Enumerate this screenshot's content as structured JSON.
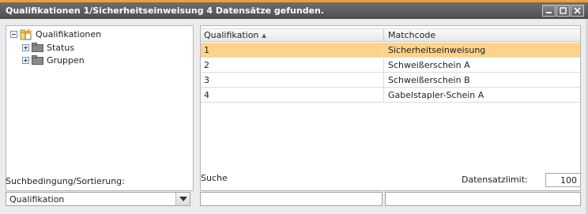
{
  "window": {
    "title": "Qualifikationen 1/Sicherheitseinweisung 4 Datensätze gefunden.",
    "buttons": [
      "minimize-icon",
      "maximize-icon",
      "close-icon"
    ]
  },
  "tree": {
    "root": {
      "label": "Qualifikationen",
      "icon": "root-folder-icon"
    },
    "children": [
      {
        "label": "Status",
        "icon": "folder-icon"
      },
      {
        "label": "Gruppen",
        "icon": "folder-icon"
      }
    ]
  },
  "grid": {
    "columns": [
      "Qualifikation",
      "Matchcode"
    ],
    "sort": {
      "column": "Qualifikation",
      "direction": "ascending"
    },
    "rows": [
      {
        "qualifikation": "1",
        "matchcode": "Sicherheitseinweisung",
        "selected": true
      },
      {
        "qualifikation": "2",
        "matchcode": "Schweißerschein A",
        "selected": false
      },
      {
        "qualifikation": "3",
        "matchcode": "Schweißerschein B",
        "selected": false
      },
      {
        "qualifikation": "4",
        "matchcode": "Gabelstapler-Schein A",
        "selected": false
      }
    ]
  },
  "search": {
    "condition_label": "Suchbedingung/Sortierung:",
    "condition_value": "Qualifikation",
    "search_label": "Suche",
    "search_value": "",
    "search_value_2": "",
    "limit_label": "Datensatzlimit:",
    "limit_value": "100"
  },
  "colors": {
    "title_accent": "#f0a030",
    "selected_row": "#fcd28c"
  }
}
